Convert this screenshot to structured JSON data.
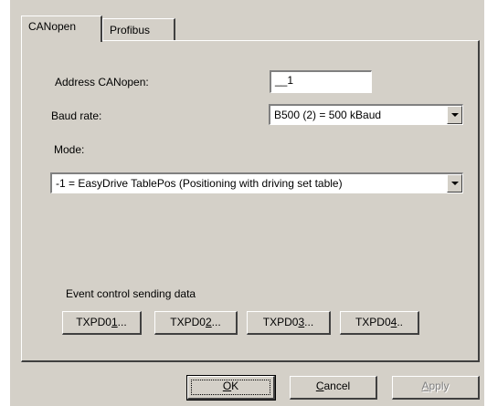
{
  "tabs": [
    {
      "label": "CANopen",
      "active": true
    },
    {
      "label": "Profibus",
      "active": false
    }
  ],
  "address": {
    "label": "Address CANopen:",
    "value": "__1"
  },
  "baud": {
    "label": "Baud rate:",
    "value": "B500 (2) = 500 kBaud"
  },
  "mode": {
    "label": "Mode:",
    "value": "-1 = EasyDrive TablePos (Positioning with driving set table)"
  },
  "event_group": {
    "title": "Event control sending data",
    "buttons": [
      {
        "prefix": "TXPD0",
        "accel": "1",
        "suffix": "..."
      },
      {
        "prefix": "TXPD0",
        "accel": "2",
        "suffix": "..."
      },
      {
        "prefix": "TXPD0",
        "accel": "3",
        "suffix": "..."
      },
      {
        "prefix": "TXPD0",
        "accel": "4",
        "suffix": ".."
      }
    ]
  },
  "footer": {
    "ok": {
      "accel": "O",
      "rest": "K"
    },
    "cancel": {
      "accel": "C",
      "rest": "ancel"
    },
    "apply": {
      "accel": "A",
      "rest": "pply"
    }
  },
  "colors": {
    "dialog_bg": "#d4d0c8",
    "disabled_text": "#808080"
  }
}
